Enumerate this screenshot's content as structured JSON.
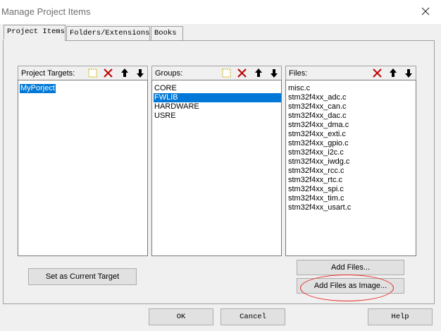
{
  "window": {
    "title": "Manage Project Items"
  },
  "tabs": [
    {
      "label": "Project Items",
      "active": true
    },
    {
      "label": "Folders/Extensions",
      "active": false
    },
    {
      "label": "Books",
      "active": false
    }
  ],
  "targets": {
    "label": "Project Targets:",
    "items": [
      "MyPorject"
    ],
    "selected": "MyPorject"
  },
  "groups": {
    "label": "Groups:",
    "items": [
      "CORE",
      "FWLIB",
      "HARDWARE",
      "USRE"
    ],
    "selected": "FWLIB"
  },
  "files": {
    "label": "Files:",
    "items": [
      "misc.c",
      "stm32f4xx_adc.c",
      "stm32f4xx_can.c",
      "stm32f4xx_dac.c",
      "stm32f4xx_dma.c",
      "stm32f4xx_exti.c",
      "stm32f4xx_gpio.c",
      "stm32f4xx_i2c.c",
      "stm32f4xx_iwdg.c",
      "stm32f4xx_rcc.c",
      "stm32f4xx_rtc.c",
      "stm32f4xx_spi.c",
      "stm32f4xx_tim.c",
      "stm32f4xx_usart.c"
    ]
  },
  "buttons": {
    "set_current_target": "Set as Current Target",
    "add_files": "Add Files...",
    "add_files_image": "Add Files as Image...",
    "ok": "OK",
    "cancel": "Cancel",
    "help": "Help"
  },
  "colors": {
    "selection": "#0078d7",
    "highlight": "#e8261f",
    "new_icon": "#d4c800",
    "delete_icon": "#c00000"
  }
}
